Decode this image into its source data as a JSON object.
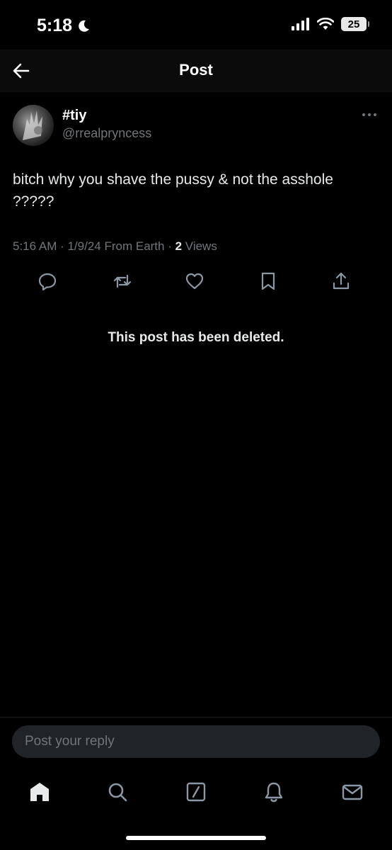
{
  "status_bar": {
    "time": "5:18",
    "battery": "25",
    "icons": [
      "moon-icon",
      "signal-icon",
      "wifi-icon",
      "battery-icon"
    ]
  },
  "header": {
    "title": "Post",
    "back_icon": "arrow-left-icon"
  },
  "post": {
    "display_name": "#tiy",
    "handle": "@rrealpryncess",
    "text": "bitch why you shave the pussy & not the asshole ?????",
    "timestamp": "5:16 AM · 1/9/24 From Earth · ",
    "views_count": "2",
    "views_label": " Views",
    "more_icon": "more-horizontal-icon",
    "actions": [
      "reply-icon",
      "repost-icon",
      "like-icon",
      "bookmark-icon",
      "share-icon"
    ]
  },
  "notice": {
    "text": "This post has been deleted."
  },
  "reply": {
    "placeholder": "Post your reply"
  },
  "tab_bar": {
    "tabs": [
      "home-icon",
      "search-icon",
      "grok-icon",
      "notifications-icon",
      "messages-icon"
    ]
  },
  "colors": {
    "background": "#000000",
    "primary_text": "#e7e9ea",
    "secondary_text": "#71767b",
    "input_background": "#202327"
  }
}
